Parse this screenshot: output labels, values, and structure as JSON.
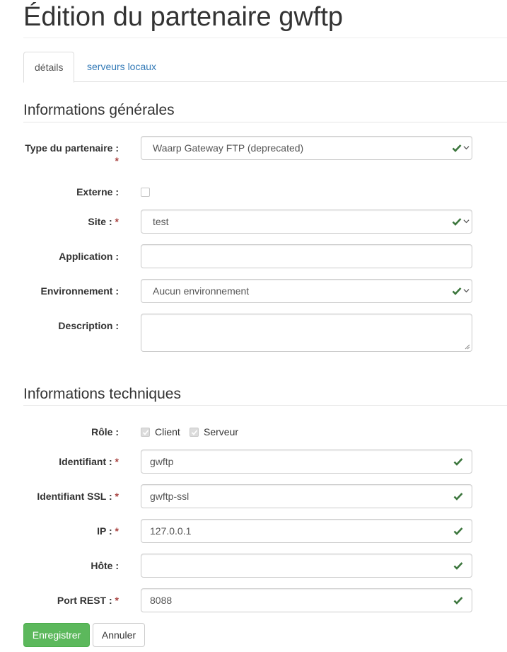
{
  "page": {
    "title": "Édition du partenaire gwftp"
  },
  "tabs": [
    {
      "label": "détails",
      "active": true
    },
    {
      "label": "serveurs locaux",
      "active": false
    }
  ],
  "sections": {
    "general": "Informations générales",
    "technical": "Informations techniques"
  },
  "general": {
    "type": {
      "label": "Type du partenaire :",
      "required": "*",
      "value": "Waarp Gateway FTP (deprecated)"
    },
    "externe": {
      "label": "Externe :",
      "checked": false
    },
    "site": {
      "label": "Site :",
      "required": "*",
      "value": "test"
    },
    "application": {
      "label": "Application :",
      "value": ""
    },
    "environnement": {
      "label": "Environnement :",
      "value": "Aucun environnement"
    },
    "description": {
      "label": "Description :",
      "value": ""
    }
  },
  "technical": {
    "role": {
      "label": "Rôle :",
      "client_label": "Client",
      "serveur_label": "Serveur",
      "client_checked": true,
      "serveur_checked": true
    },
    "identifiant": {
      "label": "Identifiant :",
      "required": "*",
      "value": "gwftp"
    },
    "identifiant_ssl": {
      "label": "Identifiant SSL :",
      "required": "*",
      "value": "gwftp-ssl"
    },
    "ip": {
      "label": "IP :",
      "required": "*",
      "value": "127.0.0.1"
    },
    "hote": {
      "label": "Hôte :",
      "value": ""
    },
    "port_rest": {
      "label": "Port REST :",
      "required": "*",
      "value": "8088"
    }
  },
  "buttons": {
    "save": "Enregistrer",
    "cancel": "Annuler"
  },
  "colors": {
    "valid": "#3c763d",
    "primary": "#5cb85c",
    "link": "#337ab7",
    "required": "#a94442"
  },
  "icons": {
    "valid": "check-icon",
    "dropdown": "chevron-down-icon"
  }
}
